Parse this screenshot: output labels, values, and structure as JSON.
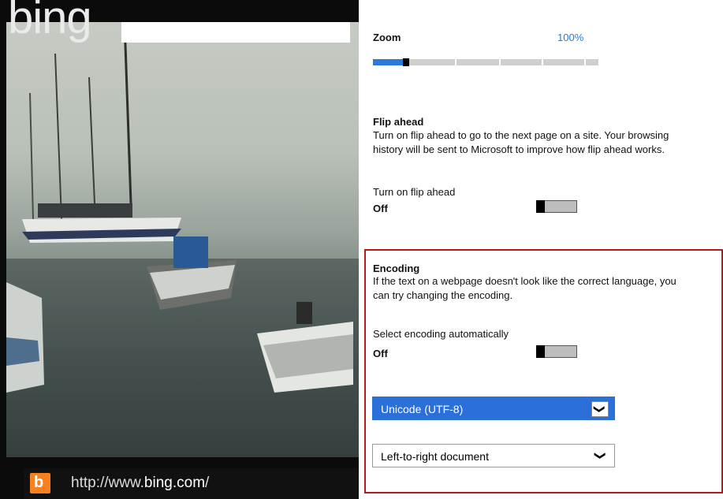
{
  "left_panel": {
    "logo": "bing",
    "address_url_prefix": "http://www.",
    "address_url_domain": "bing.com",
    "address_url_suffix": "/",
    "icon": "bing-b-icon"
  },
  "zoom": {
    "label": "Zoom",
    "value": "100%",
    "level_percent": 100,
    "accent_color": "#2a7ad9"
  },
  "flip_ahead": {
    "heading": "Flip ahead",
    "description_line1": "Turn on flip ahead to go to the next page on a site. Your browsing",
    "description_line2": "history will be sent to Microsoft to improve how flip ahead works.",
    "toggle_label": "Turn on flip ahead",
    "toggle_state": "Off"
  },
  "encoding": {
    "heading": "Encoding",
    "description_line1": "If the text on a webpage doesn't look like the correct language, you",
    "description_line2": "can try changing the encoding.",
    "toggle_label": "Select encoding automatically",
    "toggle_state": "Off",
    "encoding_select_value": "Unicode (UTF-8)",
    "direction_select_value": "Left-to-right document",
    "highlight_color": "#b51a1a"
  }
}
